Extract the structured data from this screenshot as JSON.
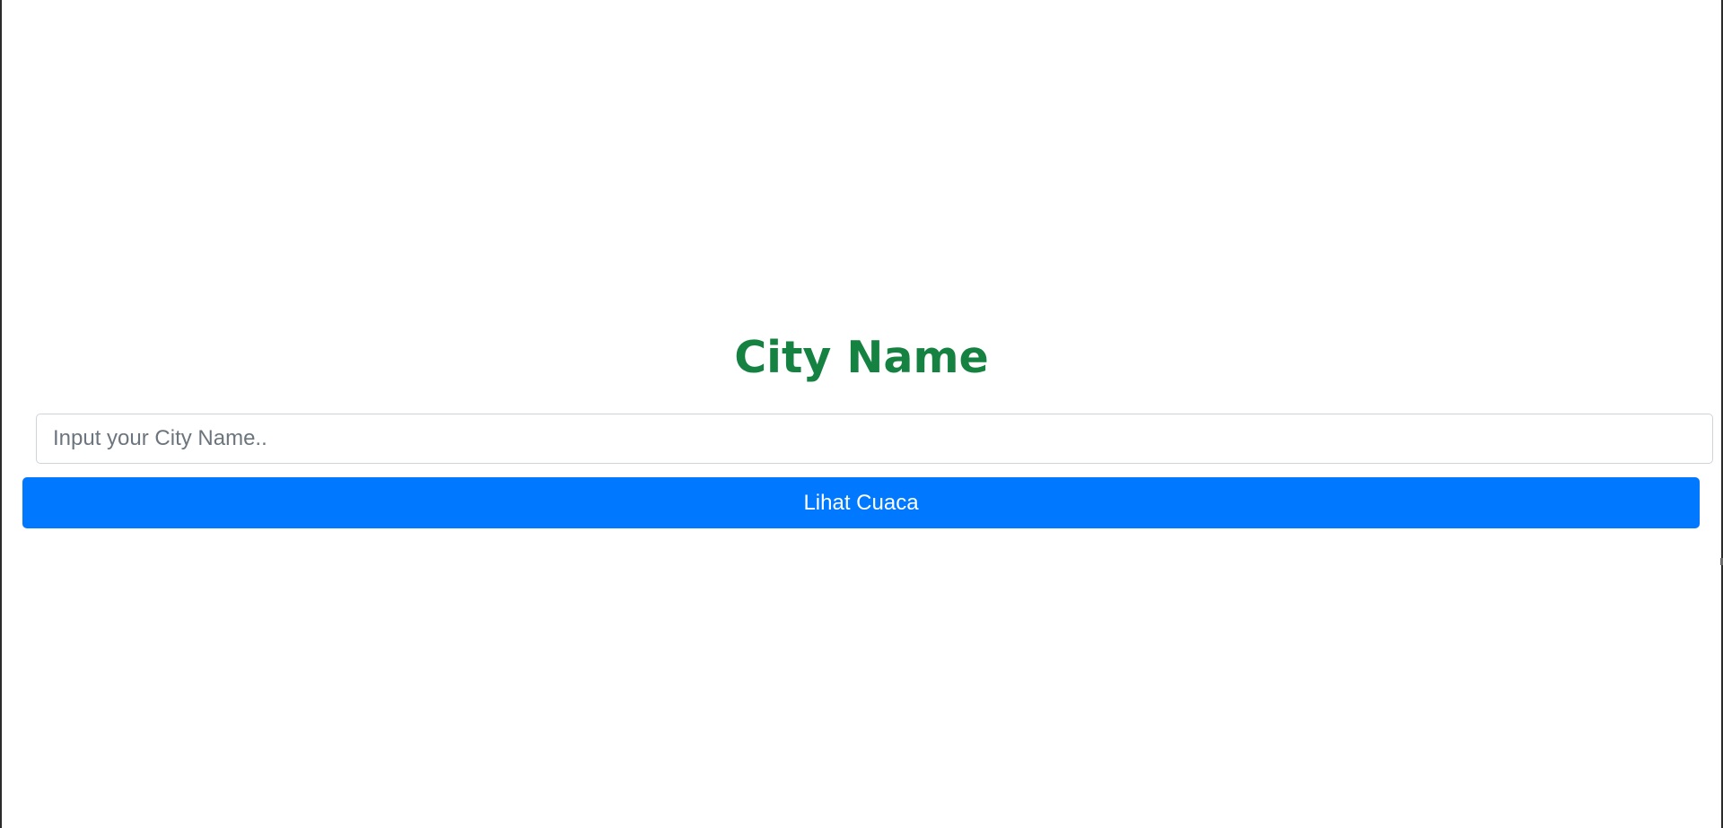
{
  "form": {
    "title": "City Name",
    "city_input": {
      "placeholder": "Input your City Name..",
      "value": ""
    },
    "submit_label": "Lihat Cuaca"
  },
  "colors": {
    "title": "#168241",
    "button": "#0078ff",
    "button_text": "#ffffff",
    "input_border": "#ced4da",
    "placeholder": "#6c757d"
  }
}
